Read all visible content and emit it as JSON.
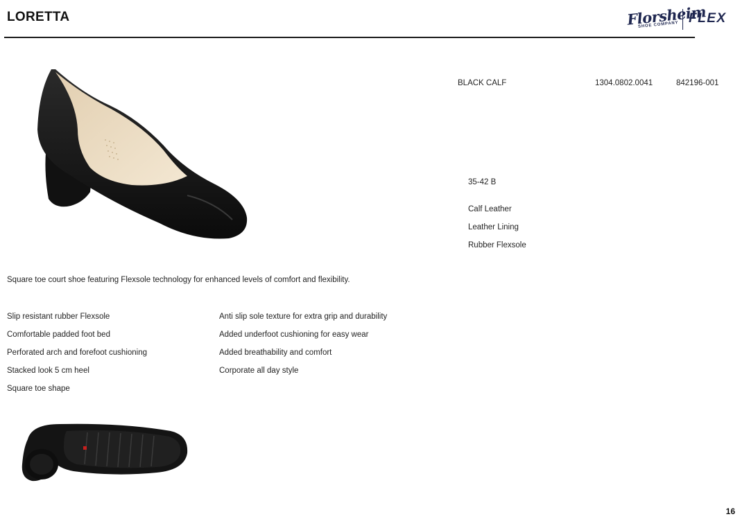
{
  "header": {
    "title": "LORETTA",
    "brand": {
      "script": "Florsheim",
      "sub": "SHOE COMPANY",
      "line": "FLEX"
    }
  },
  "product": {
    "color": "BLACK CALF",
    "code": "1304.0802.0041",
    "article": "842196-001",
    "sizes": "35-42 B",
    "materials": [
      "Calf Leather",
      "Leather Lining",
      "Rubber Flexsole"
    ],
    "description": "Square toe court shoe featuring Flexsole technology for enhanced levels of comfort and flexibility."
  },
  "features": {
    "left": [
      "Slip resistant rubber Flexsole",
      "Comfortable padded foot bed",
      "Perforated arch and forefoot cushioning",
      "Stacked look 5 cm heel",
      "Square toe shape"
    ],
    "right": [
      "Anti slip sole texture for extra grip and durability",
      "Added underfoot cushioning for easy wear",
      "Added breathability and comfort",
      "Corporate all day style"
    ]
  },
  "page_number": "16",
  "colors": {
    "brand": "#1f2750",
    "text": "#222222",
    "rule": "#1a1a1a"
  }
}
